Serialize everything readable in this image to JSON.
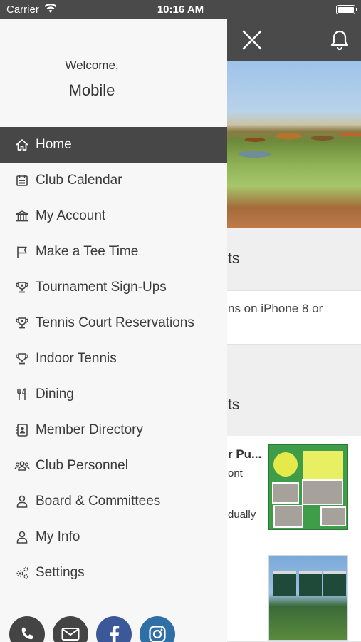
{
  "status_bar": {
    "carrier": "Carrier",
    "time": "10:16 AM"
  },
  "drawer": {
    "welcome": "Welcome,",
    "username": "Mobile",
    "menu": [
      {
        "label": "Home",
        "icon": "home-icon",
        "active": true
      },
      {
        "label": "Club Calendar",
        "icon": "calendar-icon"
      },
      {
        "label": "My Account",
        "icon": "bank-icon"
      },
      {
        "label": "Make a Tee Time",
        "icon": "flag-icon"
      },
      {
        "label": "Tournament Sign-Ups",
        "icon": "trophy-icon"
      },
      {
        "label": "Tennis Court Reservations",
        "icon": "trophy-icon"
      },
      {
        "label": "Indoor Tennis",
        "icon": "trophy-outline-icon"
      },
      {
        "label": "Dining",
        "icon": "utensils-icon"
      },
      {
        "label": "Member Directory",
        "icon": "contact-book-icon"
      },
      {
        "label": "Club Personnel",
        "icon": "users-icon"
      },
      {
        "label": "Board & Committees",
        "icon": "user-icon"
      },
      {
        "label": "My Info",
        "icon": "user-icon"
      },
      {
        "label": "Settings",
        "icon": "gears-icon"
      }
    ],
    "social": [
      "phone-icon",
      "mail-icon",
      "facebook-icon",
      "instagram-icon"
    ]
  },
  "background": {
    "section1_title": "ts",
    "notice_text": "ns on iPhone 8 or",
    "section2_title": "ts",
    "event1": {
      "title": "r Pu...",
      "line1": "ont",
      "line2": "dually"
    }
  },
  "colors": {
    "header": "#4a4a4a",
    "active_item": "#474747",
    "facebook": "#3b5998",
    "instagram": "#2f6fa8"
  }
}
